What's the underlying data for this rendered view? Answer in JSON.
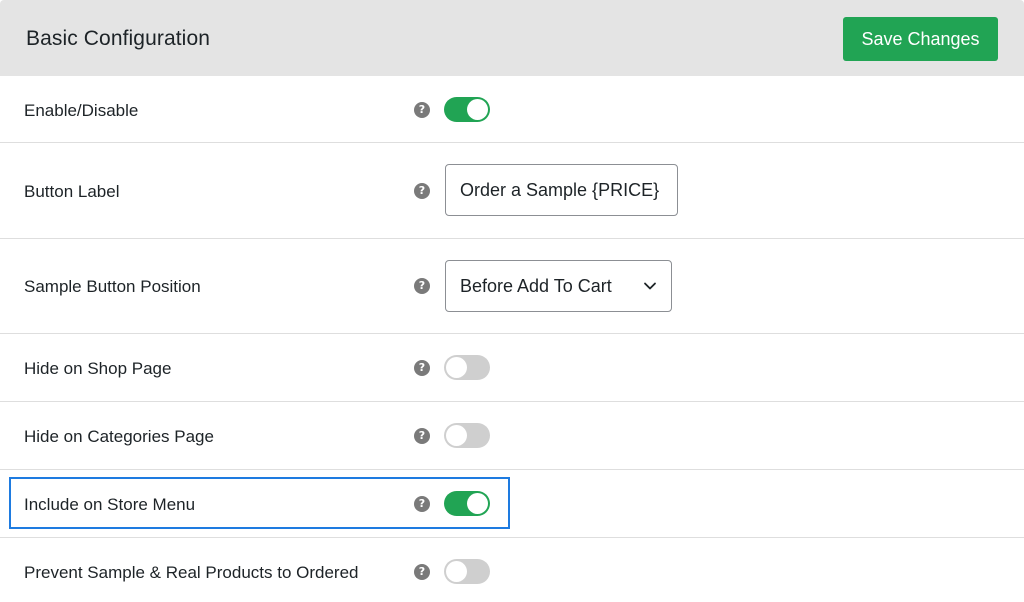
{
  "header": {
    "title": "Basic Configuration",
    "save_label": "Save Changes"
  },
  "help_icon_glyph": "?",
  "rows": [
    {
      "label": "Enable/Disable",
      "control": "toggle",
      "checked": true
    },
    {
      "label": "Button Label",
      "control": "text",
      "value": "Order a Sample {PRICE}"
    },
    {
      "label": "Sample Button Position",
      "control": "select",
      "value": "Before Add To Cart"
    },
    {
      "label": "Hide on Shop Page",
      "control": "toggle",
      "checked": false
    },
    {
      "label": "Hide on Categories Page",
      "control": "toggle",
      "checked": false
    },
    {
      "label": "Include on Store Menu",
      "control": "toggle",
      "checked": true
    },
    {
      "label": "Prevent Sample & Real Products to Ordered",
      "control": "toggle",
      "checked": false
    }
  ],
  "colors": {
    "accent_green": "#21a454",
    "toggle_off": "#cfcfcf",
    "highlight_blue": "#1e7be0",
    "header_bg": "#e4e4e4"
  }
}
